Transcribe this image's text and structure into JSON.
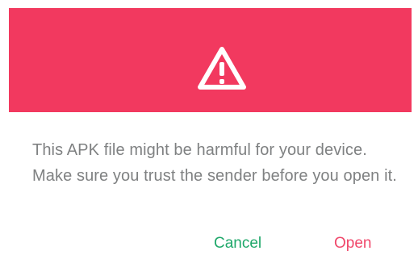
{
  "dialog": {
    "message": "This APK file might be harmful for your device. Make sure you trust the sender before you open it.",
    "icon": "warning-triangle-icon",
    "colors": {
      "header": "#f2395f",
      "cancel": "#1fa86a",
      "open": "#f0486b",
      "text": "#7f8182"
    },
    "buttons": {
      "cancel_label": "Cancel",
      "open_label": "Open"
    }
  }
}
